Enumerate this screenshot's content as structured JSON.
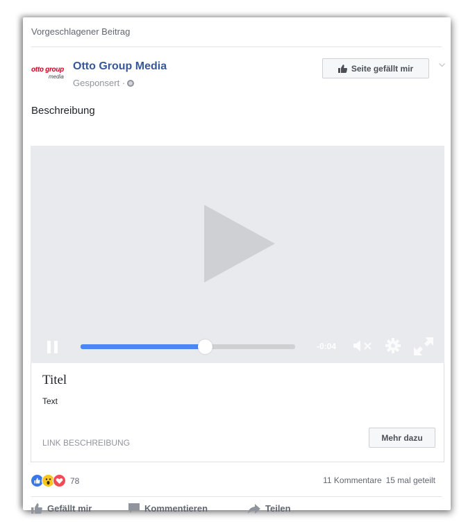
{
  "header": {
    "suggested_label": "Vorgeschlagener Beitrag"
  },
  "page": {
    "logo_main": "otto group",
    "logo_sub": "media",
    "name": "Otto Group Media",
    "sponsored": "Gesponsert ·"
  },
  "like_page_label": "Seite gefällt mir",
  "post": {
    "description": "Beschreibung"
  },
  "video": {
    "time_remaining": "-0:04",
    "progress": 0.58,
    "colors": {
      "progress": "#4a87f0",
      "background": "#e9eaed"
    }
  },
  "attachment": {
    "title": "Titel",
    "text": "Text",
    "link_description": "LINK BESCHREIBUNG",
    "cta_label": "Mehr dazu"
  },
  "engagement": {
    "reaction_icons": [
      "like-reaction-icon",
      "wow-reaction-icon",
      "love-reaction-icon"
    ],
    "reaction_count": "78",
    "comments": "11 Kommentare",
    "shares": "15 mal geteilt"
  },
  "actions": {
    "like": "Gefällt mir",
    "comment": "Kommentieren",
    "share": "Teilen"
  }
}
